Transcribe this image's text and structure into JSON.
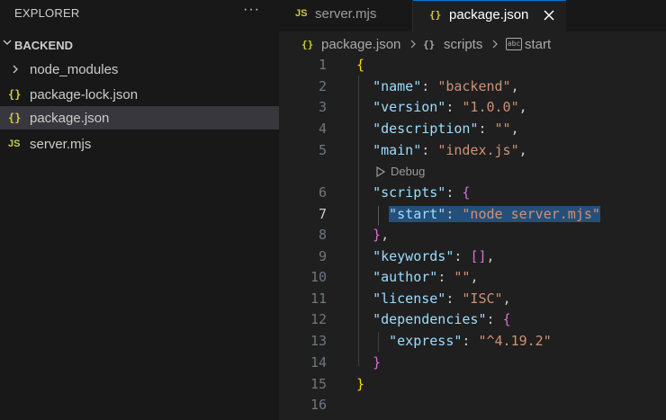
{
  "explorer": {
    "title": "EXPLORER",
    "more_label": "···",
    "section_title": "BACKEND",
    "items": [
      {
        "label": "node_modules",
        "icon": "chevron-right-icon"
      },
      {
        "label": "package-lock.json",
        "icon": "json-icon",
        "glyph": "{}"
      },
      {
        "label": "package.json",
        "icon": "json-icon",
        "glyph": "{}",
        "selected": true
      },
      {
        "label": "server.mjs",
        "icon": "js-icon",
        "glyph": "JS"
      }
    ]
  },
  "tabs": [
    {
      "label": "server.mjs",
      "icon_glyph": "JS",
      "active": false
    },
    {
      "label": "package.json",
      "icon_glyph": "{}",
      "active": true
    }
  ],
  "breadcrumb": {
    "file": "package.json",
    "file_glyph": "{}",
    "section": "scripts",
    "section_glyph": "{}",
    "key_glyph": "abc",
    "key": "start"
  },
  "codelens": "Debug",
  "line_numbers": [
    "1",
    "2",
    "3",
    "4",
    "5",
    "6",
    "7",
    "8",
    "9",
    "10",
    "11",
    "12",
    "13",
    "14",
    "15",
    "16"
  ],
  "code": {
    "l1_brace": "{",
    "l2_key": "\"name\"",
    "l2_colon": ": ",
    "l2_val": "\"backend\"",
    "l2_comma": ",",
    "l3_key": "\"version\"",
    "l3_colon": ": ",
    "l3_val": "\"1.0.0\"",
    "l3_comma": ",",
    "l4_key": "\"description\"",
    "l4_colon": ": ",
    "l4_val": "\"\"",
    "l4_comma": ",",
    "l5_key": "\"main\"",
    "l5_colon": ": ",
    "l5_val": "\"index.js\"",
    "l5_comma": ",",
    "l6_key": "\"scripts\"",
    "l6_colon": ": ",
    "l6_brace": "{",
    "l7_key": "\"start\"",
    "l7_colon": ": ",
    "l7_val": "\"node server.mjs\"",
    "l8_brace": "}",
    "l8_comma": ",",
    "l9_key": "\"keywords\"",
    "l9_colon": ": ",
    "l9_val": "[]",
    "l9_comma": ",",
    "l10_key": "\"author\"",
    "l10_colon": ": ",
    "l10_val": "\"\"",
    "l10_comma": ",",
    "l11_key": "\"license\"",
    "l11_colon": ": ",
    "l11_val": "\"ISC\"",
    "l11_comma": ",",
    "l12_key": "\"dependencies\"",
    "l12_colon": ": ",
    "l12_brace": "{",
    "l13_key": "\"express\"",
    "l13_colon": ": ",
    "l13_val": "\"^4.19.2\"",
    "l14_brace": "}",
    "l15_brace": "}"
  },
  "colors": {
    "accent": "#0078d4",
    "json_key": "#9cdcfe",
    "json_string": "#ce9178",
    "bracket_level1": "#ffd700",
    "bracket_level2": "#da70d6",
    "bracket_level3": "#179fff",
    "selection": "#264f78"
  }
}
